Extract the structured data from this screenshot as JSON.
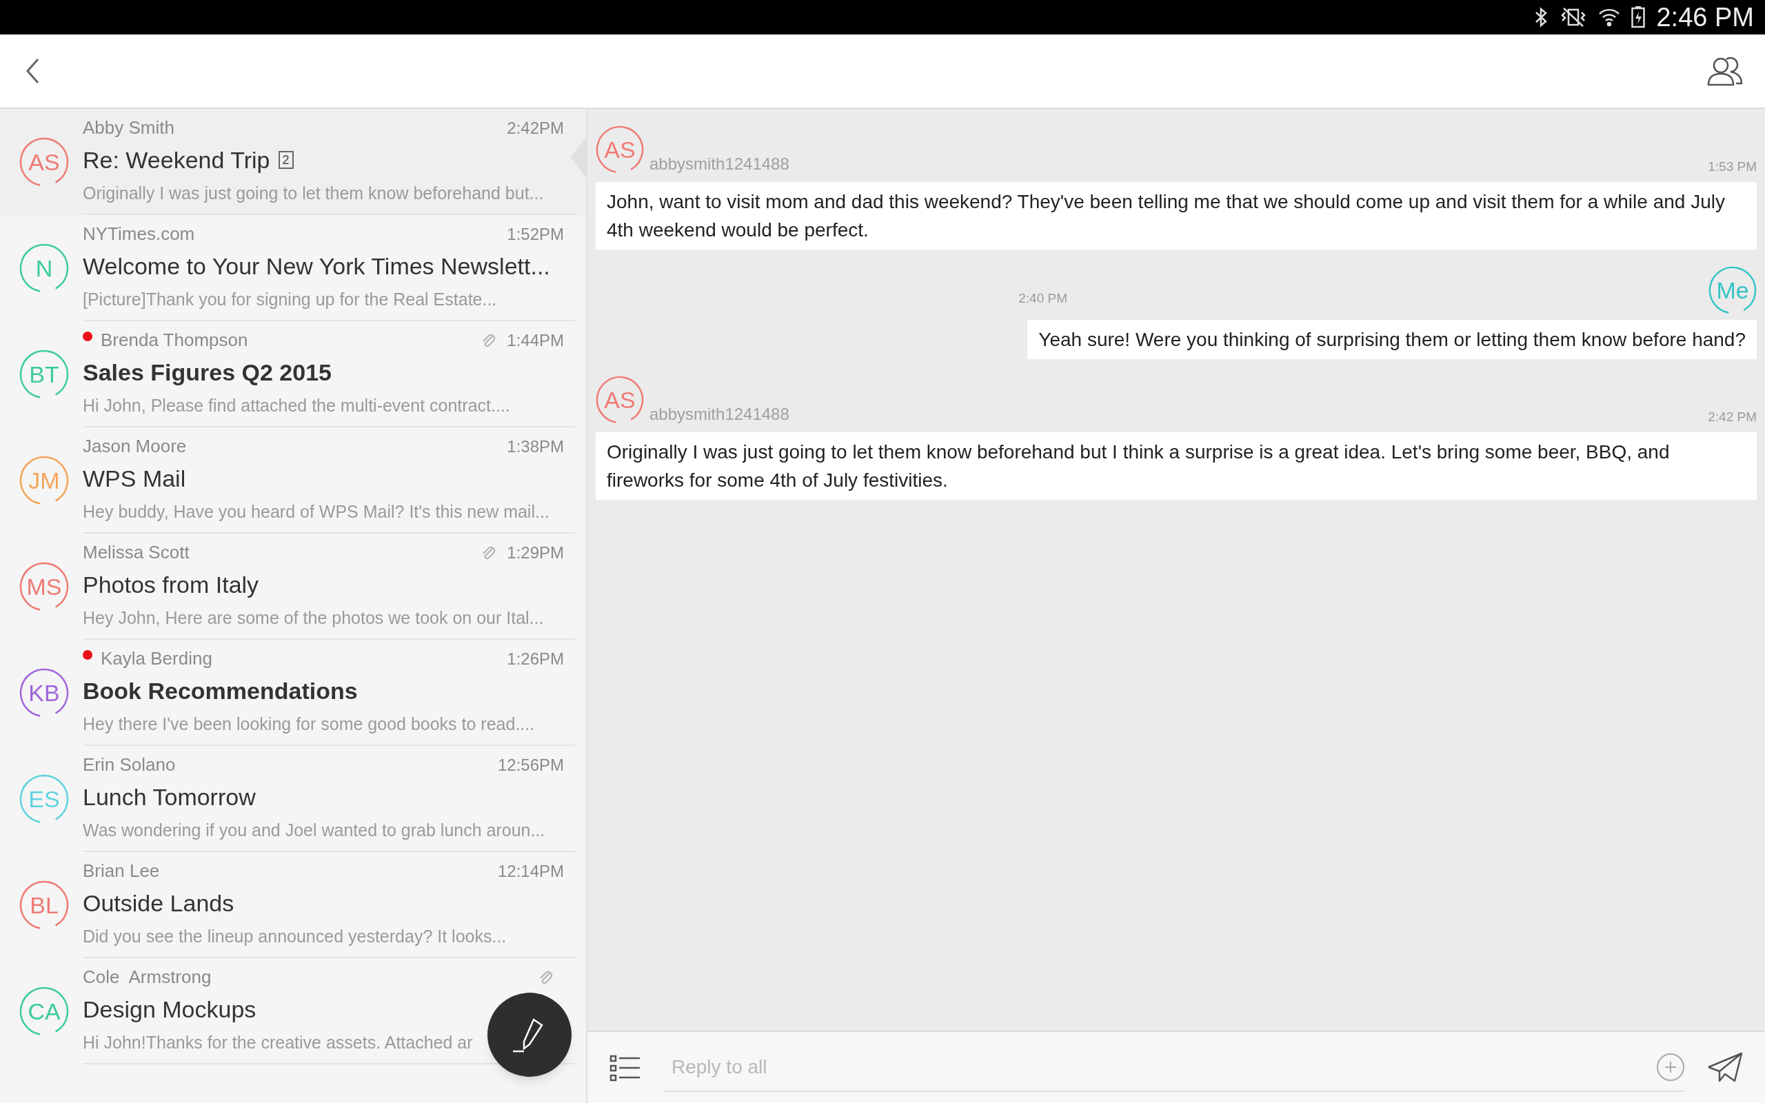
{
  "status_bar": {
    "time": "2:46 PM"
  },
  "emails": [
    {
      "initials": "AS",
      "color": "#ef7a74",
      "sender": "Abby Smith",
      "time": "2:42PM",
      "subject": "Re: Weekend Trip",
      "count": "2",
      "preview": "Originally I was just going to let them know beforehand but...",
      "unread": false,
      "attachment": false,
      "selected": true
    },
    {
      "initials": "N",
      "color": "#3dcc9a",
      "sender": "NYTimes.com",
      "time": "1:52PM",
      "subject": "Welcome to Your New York Times Newslett...",
      "preview": "[Picture]Thank you for signing up for the Real Estate...",
      "unread": false,
      "attachment": false,
      "selected": false
    },
    {
      "initials": "BT",
      "color": "#3dcc9a",
      "sender": "Brenda Thompson",
      "time": "1:44PM",
      "subject": "Sales Figures Q2 2015",
      "preview": "Hi John, Please find attached the multi-event contract....",
      "unread": true,
      "attachment": true,
      "selected": false
    },
    {
      "initials": "JM",
      "color": "#f5a55a",
      "sender": "Jason Moore",
      "time": "1:38PM",
      "subject": "WPS Mail",
      "preview": "Hey buddy, Have you heard of WPS Mail? It's this new mail...",
      "unread": false,
      "attachment": false,
      "selected": false
    },
    {
      "initials": "MS",
      "color": "#ef7a74",
      "sender": "Melissa Scott",
      "time": "1:29PM",
      "subject": "Photos from Italy",
      "preview": "Hey John, Here are some of the photos we took on our Ital...",
      "unread": false,
      "attachment": true,
      "selected": false
    },
    {
      "initials": "KB",
      "color": "#a066d8",
      "sender": "Kayla Berding",
      "time": "1:26PM",
      "subject": "Book Recommendations",
      "preview": "Hey there I've been looking for some good books to read....",
      "unread": true,
      "attachment": false,
      "selected": false
    },
    {
      "initials": "ES",
      "color": "#5fd3e0",
      "sender": "Erin Solano",
      "time": "12:56PM",
      "subject": "Lunch Tomorrow",
      "preview": "Was wondering if you and Joel wanted to grab lunch aroun...",
      "unread": false,
      "attachment": false,
      "selected": false
    },
    {
      "initials": "BL",
      "color": "#ef7a74",
      "sender": "Brian Lee",
      "time": "12:14PM",
      "subject": "Outside Lands",
      "preview": "Did you see the lineup announced yesterday? It looks...",
      "unread": false,
      "attachment": false,
      "selected": false
    },
    {
      "initials": "CA",
      "color": "#3dcc9a",
      "sender": "Cole  Armstrong",
      "subject": "Design Mockups",
      "preview": "Hi John!Thanks for the creative assets. Attached ar",
      "unread": false,
      "attachment": true,
      "selected": false
    }
  ],
  "messages": [
    {
      "kind": "incoming",
      "initials": "AS",
      "color": "#ef7a74",
      "user": "abbysmith1241488",
      "time": "1:53 PM",
      "text": "John, want to visit mom and dad this weekend? They've been telling me that we should come up and visit them for a while and July 4th weekend would be perfect."
    },
    {
      "kind": "outgoing",
      "initials": "Me",
      "color": "#35c4c4",
      "time": "2:40 PM",
      "text": "Yeah sure! Were you thinking of surprising them or letting them know before hand?"
    },
    {
      "kind": "incoming",
      "initials": "AS",
      "color": "#ef7a74",
      "user": "abbysmith1241488",
      "time": "2:42 PM",
      "text": "Originally I was just going to let them know beforehand but I think a surprise is a great idea. Let's bring some beer, BBQ, and fireworks for some 4th of July festivities."
    }
  ],
  "reply": {
    "placeholder": "Reply to all"
  }
}
